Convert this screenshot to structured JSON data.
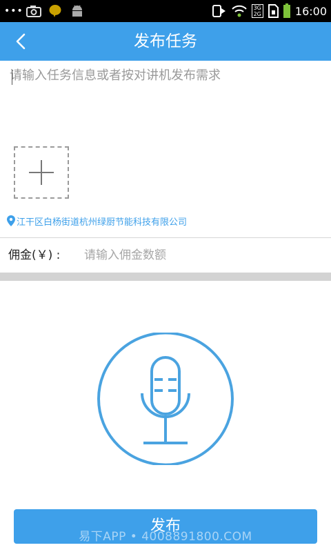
{
  "status_bar": {
    "time": "16:00",
    "overflow_label": "•••",
    "network_badge_top": "3G",
    "network_badge_bottom": "2G"
  },
  "header": {
    "title": "发布任务",
    "back_icon": "chevron-left-icon"
  },
  "task_form": {
    "description_placeholder": "请输入任务信息或者按对讲机发布需求",
    "description_value": "",
    "add_photo_icon": "plus-icon",
    "location_icon": "location-pin-icon",
    "location_text": "江干区白杨街道杭州绿厨节能科技有限公司",
    "commission_label": "佣金(￥) :",
    "commission_placeholder": "请输入佣金数额",
    "commission_value": ""
  },
  "voice": {
    "mic_icon": "microphone-icon"
  },
  "footer": {
    "publish_label": "发布",
    "watermark": "易下APP • 4008891800.COM"
  },
  "colors": {
    "accent": "#3ea0ea",
    "status_bar": "#000000",
    "separator": "#d3d3d3",
    "battery": "#7ec23a"
  }
}
